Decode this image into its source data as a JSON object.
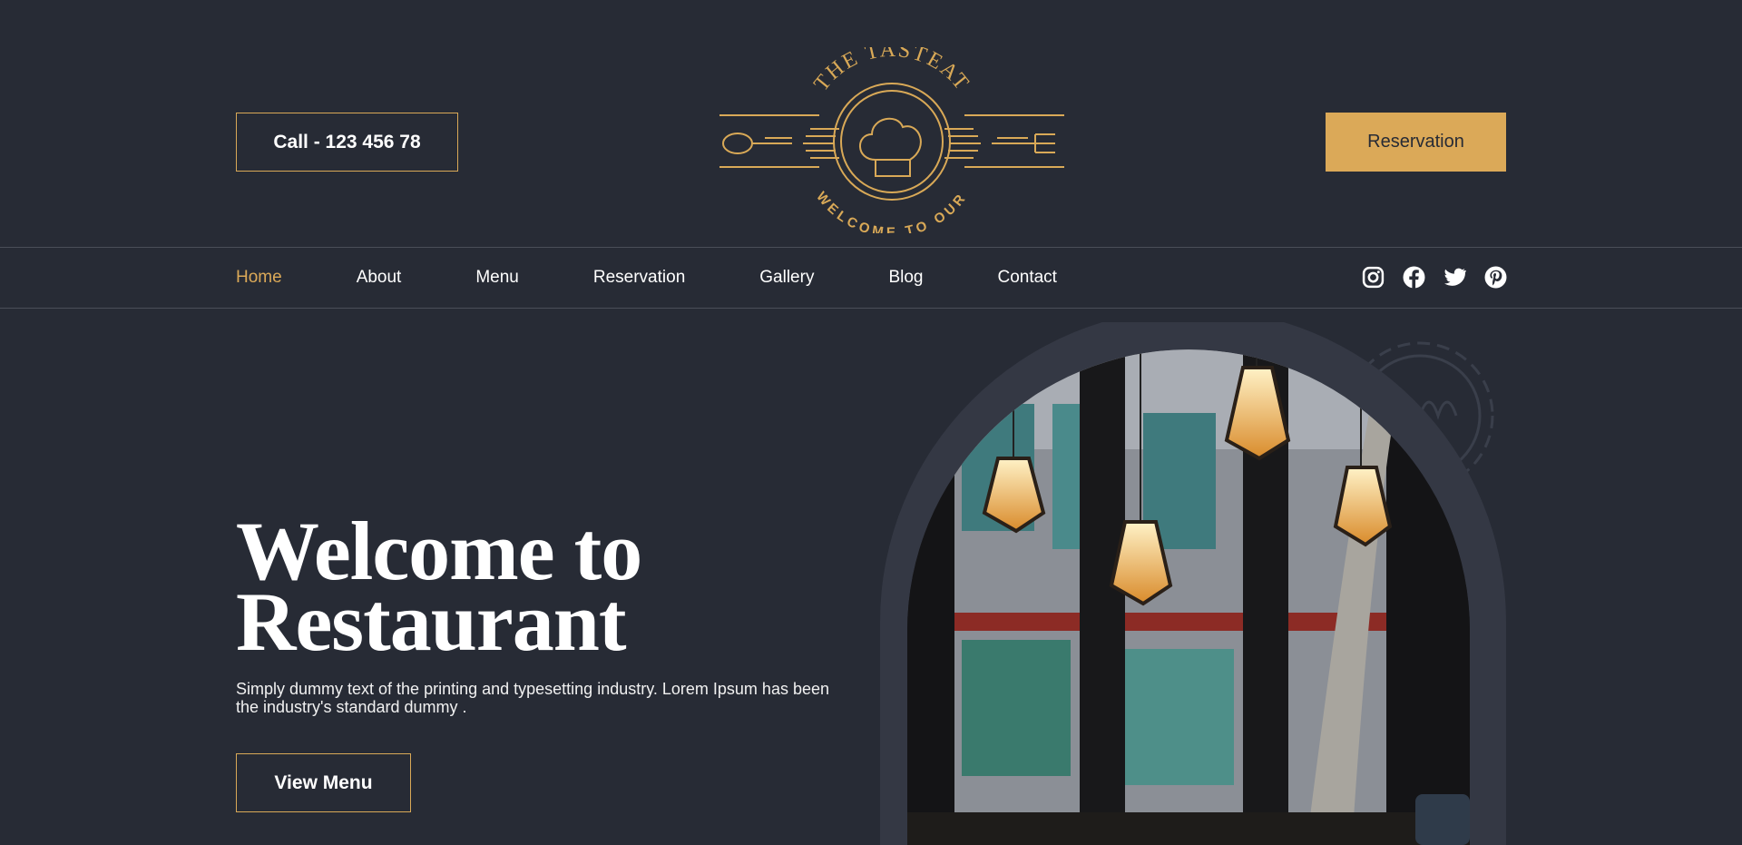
{
  "header": {
    "call_label": "Call - 123 456 78",
    "logo_top_text": "THE TASTEAT",
    "logo_bottom_text": "WELCOME TO OUR",
    "reservation_label": "Reservation"
  },
  "nav": {
    "items": [
      {
        "label": "Home",
        "active": true
      },
      {
        "label": "About"
      },
      {
        "label": "Menu"
      },
      {
        "label": "Reservation"
      },
      {
        "label": "Gallery"
      },
      {
        "label": "Blog"
      },
      {
        "label": "Contact"
      }
    ],
    "socials": [
      "instagram-icon",
      "facebook-icon",
      "twitter-icon",
      "pinterest-icon"
    ]
  },
  "hero": {
    "title_line1": "Welcome to",
    "title_line2": "Restaurant",
    "text": "Simply dummy text of the printing and typesetting industry. Lorem Ipsum has been the industry's standard dummy .",
    "button_label": "View Menu"
  },
  "colors": {
    "background": "#272b35",
    "accent": "#dba958",
    "arch": "#343844"
  }
}
